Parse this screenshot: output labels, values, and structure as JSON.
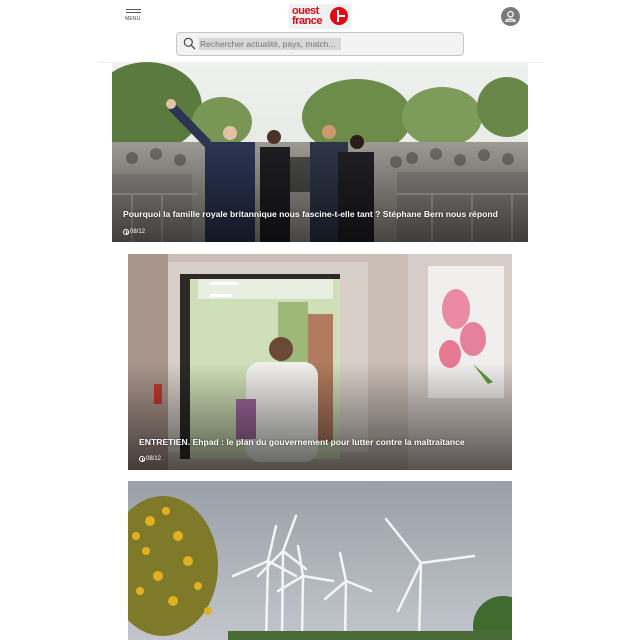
{
  "header": {
    "menu_label": "MENU",
    "logo_line1": "ouest",
    "logo_line2": "france",
    "logo_color": "#e30613"
  },
  "search": {
    "placeholder": "Rechercher actualité, pays, match..."
  },
  "articles": [
    {
      "title": "Pourquoi la famille royale britannique nous fascine-t-elle tant ? Stéphane Bern nous répond",
      "date": "08/12"
    },
    {
      "title": "ENTRETIEN. Ehpad : le plan du gouvernement pour lutter contre la maltraitance",
      "date": "08/12"
    },
    {
      "title": "",
      "date": ""
    }
  ],
  "icons": [
    "menu-icon",
    "ouest-france-logo",
    "user-account-icon",
    "search-icon",
    "clock-icon"
  ]
}
